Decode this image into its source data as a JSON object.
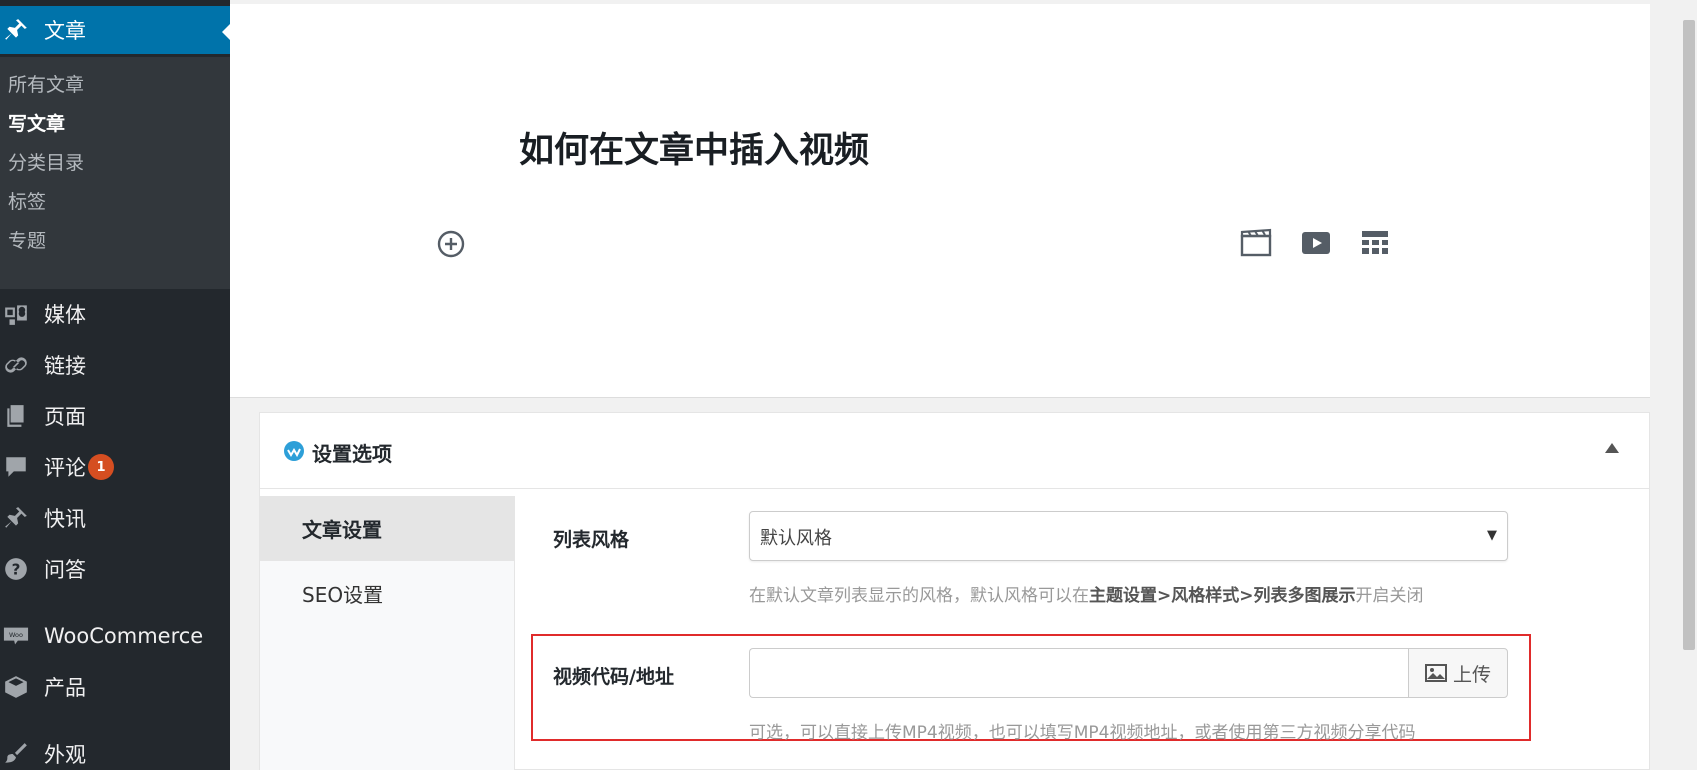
{
  "sidebar": {
    "active": {
      "label": "文章",
      "icon": "pushpin-icon"
    },
    "submenu": [
      "所有文章",
      "写文章",
      "分类目录",
      "标签",
      "专题"
    ],
    "current_submenu": "写文章",
    "items": [
      {
        "label": "媒体",
        "icon": "media-icon"
      },
      {
        "label": "链接",
        "icon": "link-icon"
      },
      {
        "label": "页面",
        "icon": "pages-icon"
      },
      {
        "label": "评论",
        "icon": "comment-icon",
        "badge": "1"
      },
      {
        "label": "快讯",
        "icon": "pushpin-icon"
      },
      {
        "label": "问答",
        "icon": "question-icon"
      },
      {
        "label": "WooCommerce",
        "icon": "woo-icon"
      },
      {
        "label": "产品",
        "icon": "box-icon"
      },
      {
        "label": "外观",
        "icon": "brush-icon"
      }
    ]
  },
  "editor": {
    "title": "如何在文章中插入视频"
  },
  "settings": {
    "title": "设置选项",
    "tabs": [
      "文章设置",
      "SEO设置"
    ],
    "active_tab": "文章设置",
    "fields": {
      "list_style": {
        "label": "列表风格",
        "value": "默认风格",
        "help_prefix": "在默认文章列表显示的风格，默认风格可以在",
        "help_bold": "主题设置>风格样式>列表多图展示",
        "help_suffix": "开启关闭"
      },
      "video": {
        "label": "视频代码/地址",
        "value": "",
        "upload_label": "上传",
        "help": "可选，可以直接上传MP4视频，也可以填写MP4视频地址，或者使用第三方视频分享代码"
      }
    }
  },
  "colors": {
    "sidebar_bg": "#23282d",
    "submenu_bg": "#32373c",
    "active_blue": "#0073aa",
    "badge": "#d54e21",
    "highlight_red": "#e02b2b"
  }
}
